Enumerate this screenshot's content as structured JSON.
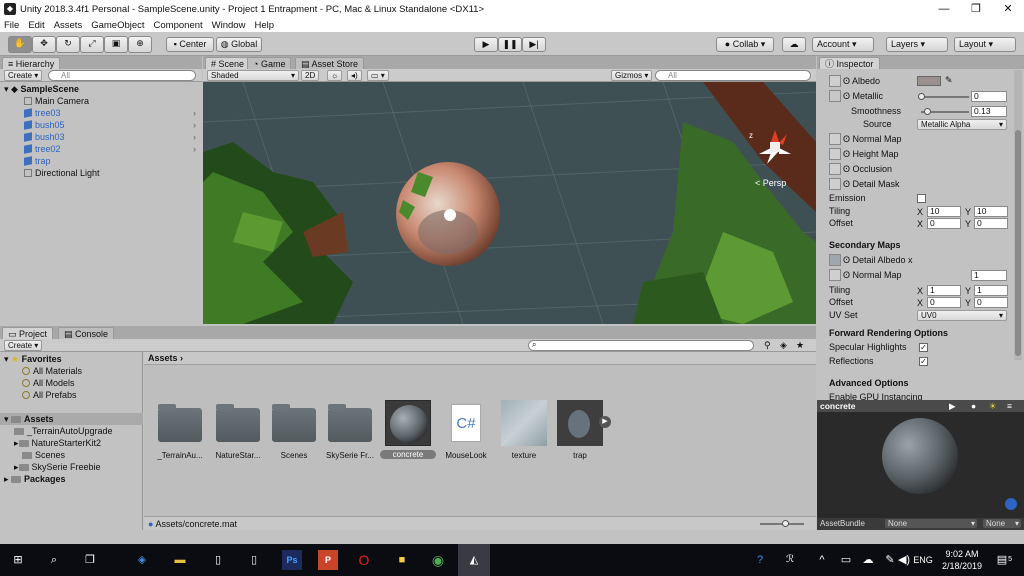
{
  "window": {
    "title": "Unity 2018.3.4f1 Personal - SampleScene.unity - Project 1 Entrapment - PC, Mac & Linux Standalone <DX11>",
    "minimize": "—",
    "maximize": "❐",
    "close": "✕"
  },
  "menu": [
    "File",
    "Edit",
    "Assets",
    "GameObject",
    "Component",
    "Window",
    "Help"
  ],
  "toolbar": {
    "center": "Center",
    "global": "Global",
    "collab": "Collab ▾",
    "account": "Account",
    "layers": "Layers",
    "layout": "Layout"
  },
  "hierarchy": {
    "tab": "Hierarchy",
    "create": "Create ▾",
    "search_placeholder": "All",
    "scene": "SampleScene",
    "items": [
      {
        "name": "Main Camera",
        "prefab": false,
        "arrow": false
      },
      {
        "name": "tree03",
        "prefab": true,
        "arrow": true
      },
      {
        "name": "bush05",
        "prefab": true,
        "arrow": true
      },
      {
        "name": "bush03",
        "prefab": true,
        "arrow": true
      },
      {
        "name": "tree02",
        "prefab": true,
        "arrow": true
      },
      {
        "name": "trap",
        "prefab": true,
        "arrow": false
      },
      {
        "name": "Directional Light",
        "prefab": false,
        "arrow": false
      }
    ]
  },
  "scene": {
    "tabs": [
      "Scene",
      "Game",
      "Asset Store"
    ],
    "shading": "Shaded",
    "mode_2d": "2D",
    "gizmos": "Gizmos ▾",
    "search_placeholder": "All",
    "persp": "< Persp"
  },
  "inspector": {
    "tab": "Inspector",
    "albedo": "Albedo",
    "metallic": "Metallic",
    "metallic_value": "0",
    "metallic_fraction": 0,
    "smoothness": "Smoothness",
    "smoothness_value": "0.13",
    "smoothness_fraction": 0.13,
    "source": "Source",
    "source_value": "Metallic Alpha",
    "normal_map": "Normal Map",
    "height_map": "Height Map",
    "occlusion": "Occlusion",
    "detail_mask": "Detail Mask",
    "emission": "Emission",
    "tiling": "Tiling",
    "offset": "Offset",
    "tiling_x": "10",
    "tiling_y": "10",
    "offset_x": "0",
    "offset_y": "0",
    "secondary_maps": "Secondary Maps",
    "detail_albedo": "Detail Albedo x",
    "normal_map2": "Normal Map",
    "normal_map2_value": "1",
    "tiling2_x": "1",
    "tiling2_y": "1",
    "offset2_x": "0",
    "offset2_y": "0",
    "uv_set": "UV Set",
    "uv_set_value": "UV0",
    "forward_rendering": "Forward Rendering Options",
    "specular_highlights": "Specular Highlights",
    "reflections": "Reflections",
    "advanced_options": "Advanced Options",
    "gpu_instancing": "Enable GPU Instancing",
    "x": "X",
    "y": "Y"
  },
  "preview": {
    "name": "concrete",
    "asset_bundle": "AssetBundle",
    "bundle_value": "None",
    "variant_value": "None"
  },
  "project": {
    "tabs": [
      "Project",
      "Console"
    ],
    "create": "Create ▾",
    "favorites": "Favorites",
    "favorite_items": [
      "All Materials",
      "All Models",
      "All Prefabs"
    ],
    "assets": "Assets",
    "asset_folders": [
      "_TerrainAutoUpgrade",
      "NatureStarterKit2",
      "Scenes",
      "SkySerie Freebie"
    ],
    "packages": "Packages",
    "breadcrumb": "Assets",
    "grid": [
      {
        "label": "_TerrainAu...",
        "kind": "folder"
      },
      {
        "label": "NatureStar...",
        "kind": "folder"
      },
      {
        "label": "Scenes",
        "kind": "folder"
      },
      {
        "label": "SkySerie Fr...",
        "kind": "folder"
      },
      {
        "label": "concrete",
        "kind": "material"
      },
      {
        "label": "MouseLook",
        "kind": "script"
      },
      {
        "label": "texture",
        "kind": "texture"
      },
      {
        "label": "trap",
        "kind": "model"
      }
    ],
    "script_glyph": "C#",
    "status_path": "Assets/concrete.mat"
  },
  "taskbar": {
    "time": "9:02 AM",
    "date": "2/18/2019",
    "lang": "ENG",
    "notif": "5"
  },
  "colors": {
    "unity_blue": "#2f64c4",
    "selection": "#3e7de0",
    "taskbar": "#0b0b12"
  }
}
